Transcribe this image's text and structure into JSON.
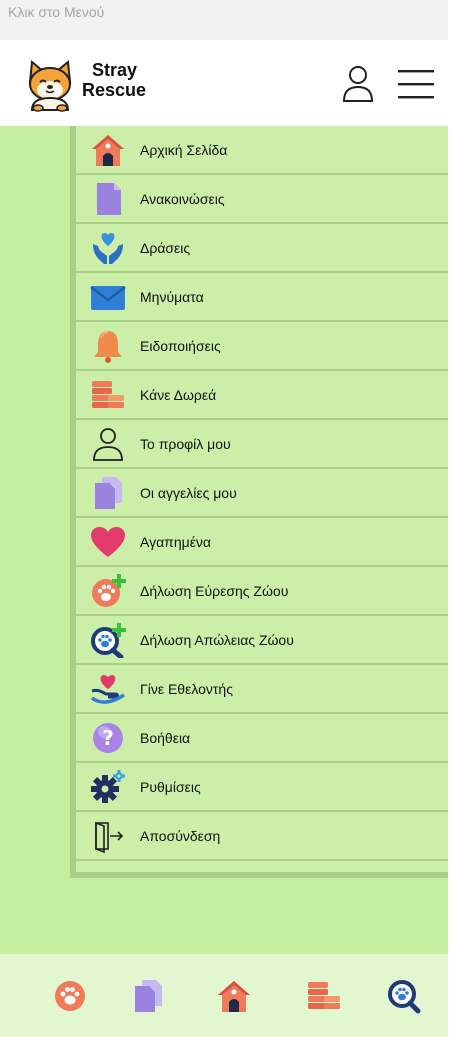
{
  "status_bar": {
    "text": "Κλικ στο Μενού"
  },
  "header": {
    "brand_line1": "Stray",
    "brand_line2": "Rescue"
  },
  "menu": {
    "items": [
      {
        "label": "Αρχική Σελίδα",
        "icon": "home-icon"
      },
      {
        "label": "Ανακοινώσεις",
        "icon": "document-icon"
      },
      {
        "label": "Δράσεις",
        "icon": "hands-heart-icon"
      },
      {
        "label": "Μηνύματα",
        "icon": "envelope-icon"
      },
      {
        "label": "Ειδοποιήσεις",
        "icon": "bell-icon"
      },
      {
        "label": "Κάνε Δωρεά",
        "icon": "coins-icon"
      },
      {
        "label": "Το προφίλ μου",
        "icon": "user-icon"
      },
      {
        "label": "Οι αγγελίες μου",
        "icon": "documents-icon"
      },
      {
        "label": "Αγαπημένα",
        "icon": "heart-icon"
      },
      {
        "label": "Δήλωση Εύρεσης Ζώου",
        "icon": "paw-add-icon"
      },
      {
        "label": "Δήλωση Απώλειας Ζώου",
        "icon": "paw-search-add-icon"
      },
      {
        "label": "Γίνε Εθελοντής",
        "icon": "volunteer-hands-icon"
      },
      {
        "label": "Βοήθεια",
        "icon": "question-icon"
      },
      {
        "label": "Ρυθμίσεις",
        "icon": "gear-icon"
      },
      {
        "label": "Αποσύνδεση",
        "icon": "logout-icon"
      }
    ]
  },
  "bottom_nav": {
    "items": [
      {
        "icon": "paw-icon"
      },
      {
        "icon": "documents-icon"
      },
      {
        "icon": "home-icon"
      },
      {
        "icon": "coins-icon"
      },
      {
        "icon": "paw-search-icon"
      }
    ]
  },
  "colors": {
    "background_green": "#c6eea0",
    "panel_border": "#a9cf86",
    "bottom_bar": "#e2f6cf"
  }
}
